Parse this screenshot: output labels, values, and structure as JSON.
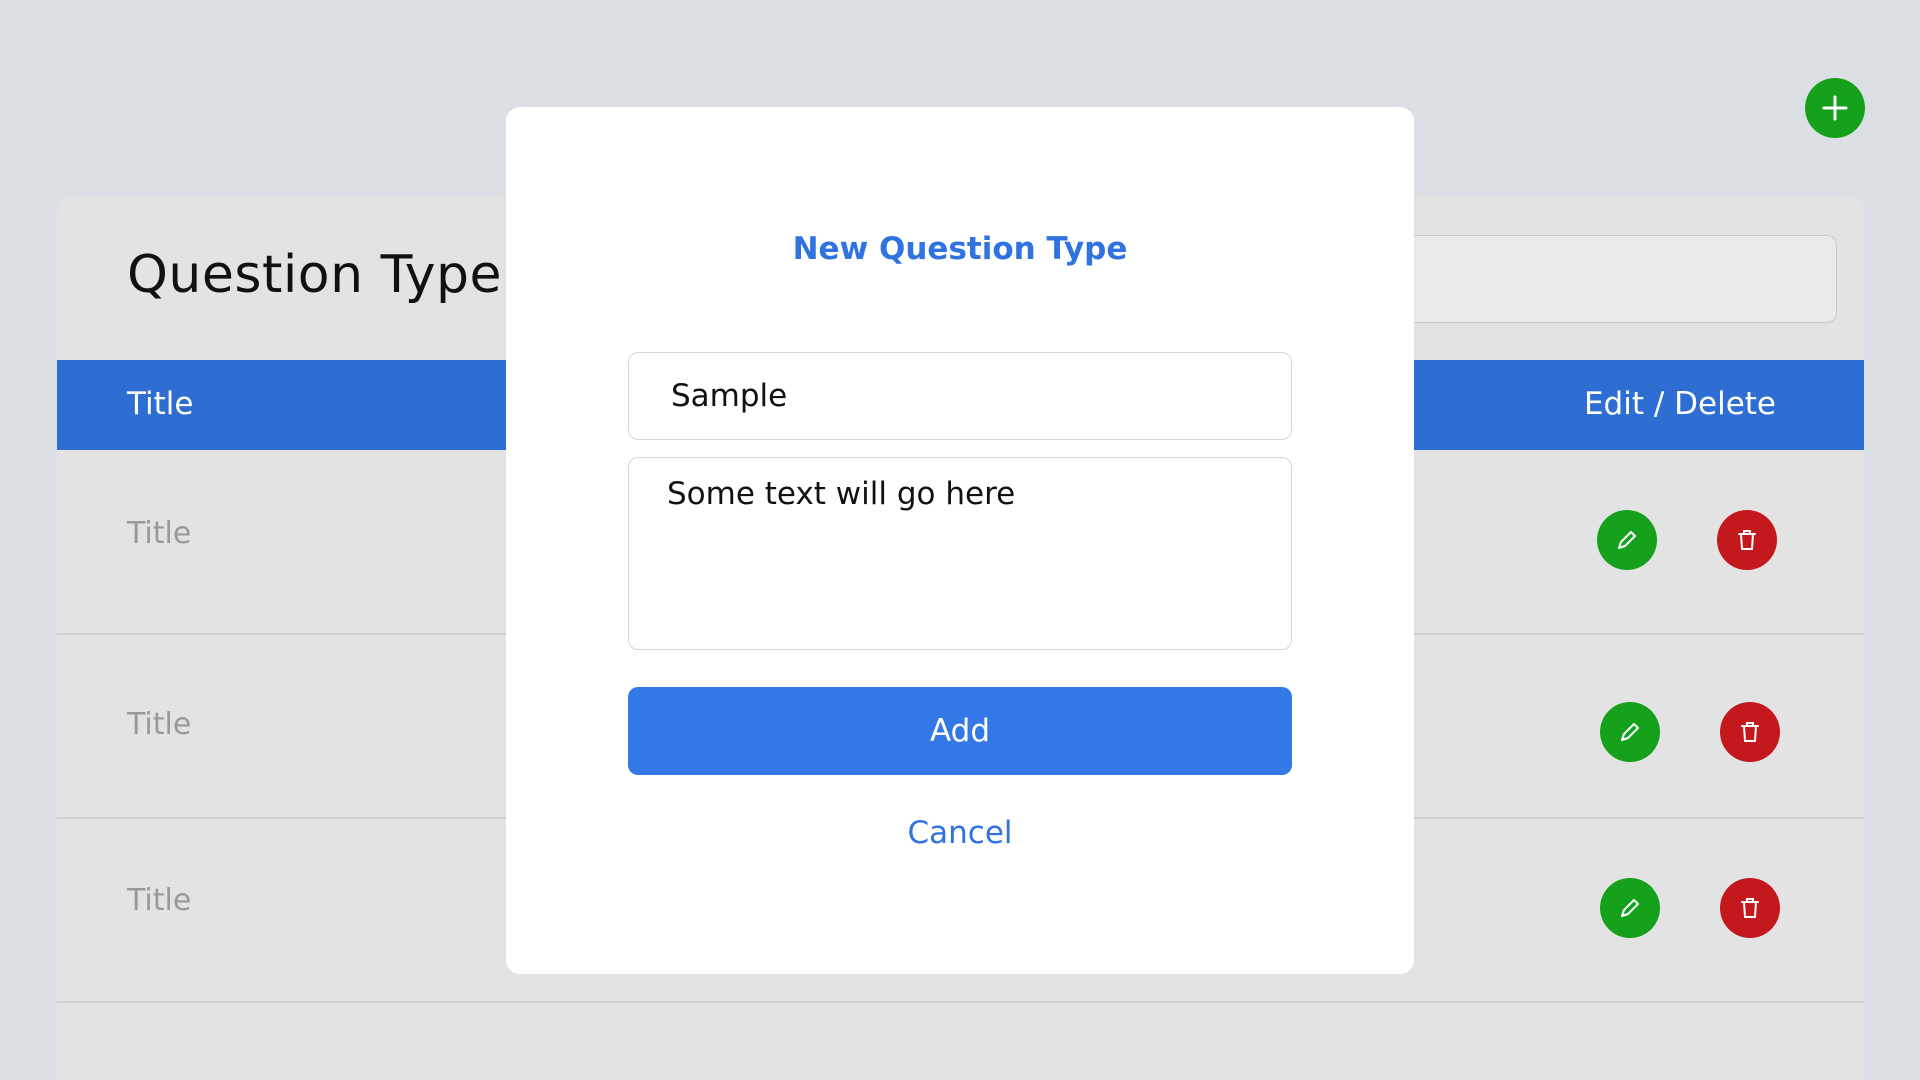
{
  "page": {
    "title": "Question Type"
  },
  "table": {
    "headers": {
      "title": "Title",
      "actions": "Edit / Delete"
    },
    "rows": [
      {
        "title": "Title"
      },
      {
        "title": "Title"
      },
      {
        "title": "Title"
      }
    ]
  },
  "modal": {
    "title": "New Question Type",
    "name_value": "Sample",
    "description_value": "Some text will go here",
    "add_label": "Add",
    "cancel_label": "Cancel"
  },
  "icons": {
    "add": "plus-icon",
    "edit": "pencil-icon",
    "delete": "trash-icon"
  },
  "colors": {
    "primary": "#2e6dd2",
    "success": "#15a11b",
    "danger": "#c3181c",
    "accent_text": "#2f72e0"
  }
}
